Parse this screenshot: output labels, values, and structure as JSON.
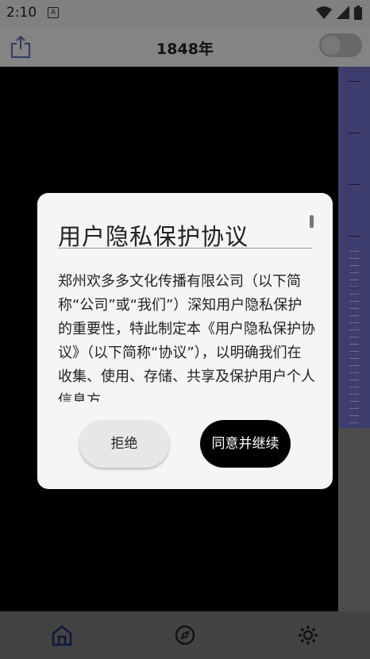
{
  "status_bar": {
    "time": "2:10",
    "badge": "A"
  },
  "app_bar": {
    "title": "1848年",
    "icons": [
      "share-icon",
      "toggle-switch"
    ]
  },
  "dialog": {
    "title": "用户隐私保护协议",
    "body": "郑州欢多多文化传播有限公司（以下简称“公司”或“我们”）深知用户隐私保护的重要性，特此制定本《用户隐私保护协议》（以下简称“协议”），以明确我们在收集、使用、存储、共享及保护用户个人信息方",
    "reject_label": "拒绝",
    "accept_label": "同意并继续"
  },
  "bottom_nav": {
    "items": [
      "home-icon",
      "compass-icon",
      "gear-icon"
    ]
  },
  "colors": {
    "accent_blue": "#6f72c7",
    "dialog_bg": "#f5f5f5",
    "accept_bg": "#000000"
  }
}
